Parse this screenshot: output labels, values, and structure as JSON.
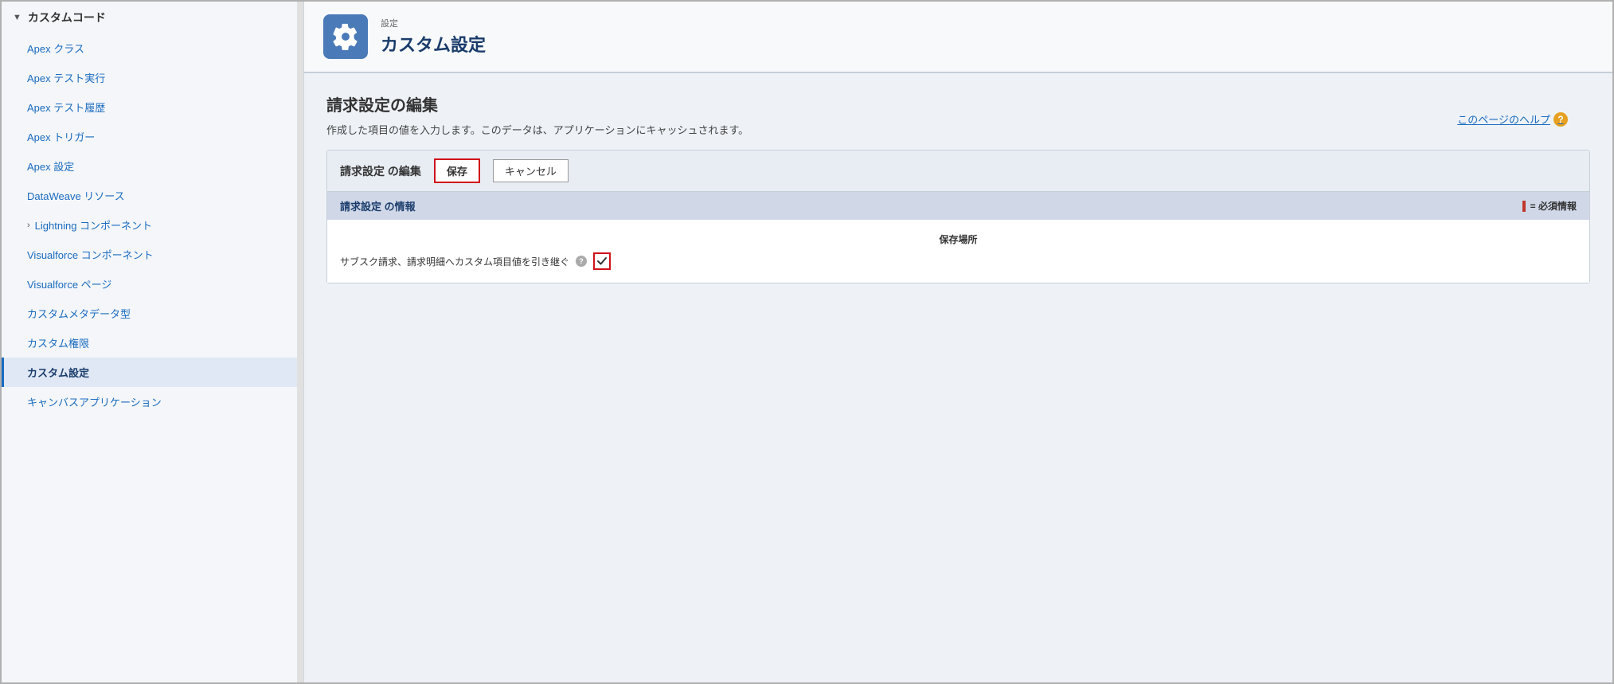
{
  "sidebar": {
    "section_label": "カスタムコード",
    "items": [
      {
        "id": "apex-class",
        "label": "Apex クラス",
        "active": false
      },
      {
        "id": "apex-test-run",
        "label": "Apex テスト実行",
        "active": false
      },
      {
        "id": "apex-test-history",
        "label": "Apex テスト履歴",
        "active": false
      },
      {
        "id": "apex-trigger",
        "label": "Apex トリガー",
        "active": false
      },
      {
        "id": "apex-settings",
        "label": "Apex 設定",
        "active": false
      },
      {
        "id": "dataweave-resources",
        "label": "DataWeave リソース",
        "active": false
      },
      {
        "id": "lightning-components",
        "label": "Lightning コンポーネント",
        "active": false,
        "expandable": true
      },
      {
        "id": "visualforce-components",
        "label": "Visualforce コンポーネント",
        "active": false
      },
      {
        "id": "visualforce-pages",
        "label": "Visualforce ページ",
        "active": false
      },
      {
        "id": "custom-metadata-type",
        "label": "カスタムメタデータ型",
        "active": false
      },
      {
        "id": "custom-permissions",
        "label": "カスタム権限",
        "active": false
      },
      {
        "id": "custom-settings",
        "label": "カスタム設定",
        "active": true
      },
      {
        "id": "canvas-app",
        "label": "キャンバスアプリケーション",
        "active": false
      }
    ]
  },
  "page_header": {
    "subtitle": "設定",
    "title": "カスタム設定"
  },
  "content": {
    "page_title": "請求設定の編集",
    "description": "作成した項目の値を入力します。このデータは、アプリケーションにキャッシュされます。",
    "help_link": "このページのヘルプ",
    "form": {
      "section_label": "請求設定 の編集",
      "save_button": "保存",
      "cancel_button": "キャンセル",
      "info_label": "請求設定 の情報",
      "required_label": "= 必須情報",
      "storage_label": "保存場所",
      "field_label": "サブスク請求、請求明細へカスタム項目値を引き継ぐ",
      "checkbox_checked": true
    }
  }
}
